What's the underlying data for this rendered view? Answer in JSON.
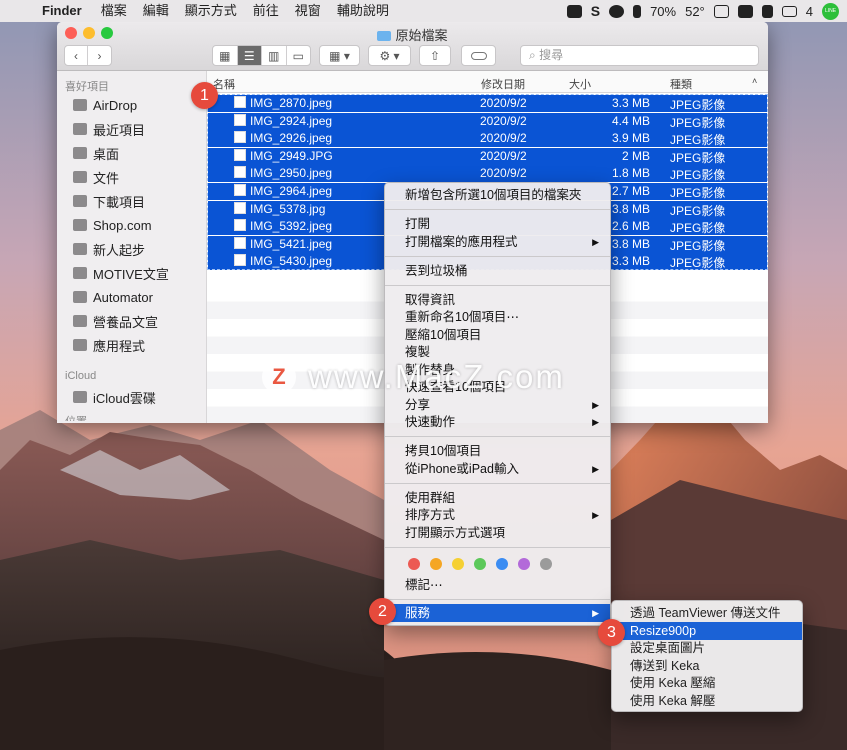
{
  "menubar": {
    "app": "Finder",
    "items": [
      "檔案",
      "編輯",
      "顯示方式",
      "前往",
      "視窗",
      "輔助說明"
    ],
    "battery": "70%",
    "temperature": "52°",
    "mail_count": "4",
    "line_label": "LINE"
  },
  "window": {
    "title": "原始檔案",
    "search_placeholder": "搜尋"
  },
  "sidebar": {
    "favorites_header": "喜好項目",
    "favorites": [
      "AirDrop",
      "最近項目",
      "桌面",
      "文件",
      "下載項目",
      "Shop.com",
      "新人起步",
      "MOTIVE文宣",
      "Automator",
      "營養品文宣",
      "應用程式"
    ],
    "icloud_header": "iCloud",
    "icloud": [
      "iCloud雲碟"
    ],
    "partial_header": "位置"
  },
  "columns": {
    "name": "名稱",
    "date": "修改日期",
    "size": "大小",
    "kind": "種類"
  },
  "files": [
    {
      "name": "IMG_2870.jpeg",
      "date": "2020/9/2",
      "size": "3.3 MB",
      "kind": "JPEG影像"
    },
    {
      "name": "IMG_2924.jpeg",
      "date": "2020/9/2",
      "size": "4.4 MB",
      "kind": "JPEG影像"
    },
    {
      "name": "IMG_2926.jpeg",
      "date": "2020/9/2",
      "size": "3.9 MB",
      "kind": "JPEG影像"
    },
    {
      "name": "IMG_2949.JPG",
      "date": "2020/9/2",
      "size": "2 MB",
      "kind": "JPEG影像"
    },
    {
      "name": "IMG_2950.jpeg",
      "date": "2020/9/2",
      "size": "1.8 MB",
      "kind": "JPEG影像"
    },
    {
      "name": "IMG_2964.jpeg",
      "date": "",
      "size": "2.7 MB",
      "kind": "JPEG影像"
    },
    {
      "name": "IMG_5378.jpg",
      "date": "",
      "size": "3.8 MB",
      "kind": "JPEG影像"
    },
    {
      "name": "IMG_5392.jpeg",
      "date": "",
      "size": "2.6 MB",
      "kind": "JPEG影像"
    },
    {
      "name": "IMG_5421.jpeg",
      "date": "",
      "size": "3.8 MB",
      "kind": "JPEG影像"
    },
    {
      "name": "IMG_5430.jpeg",
      "date": "",
      "size": "3.3 MB",
      "kind": "JPEG影像"
    }
  ],
  "context_menu": {
    "new_folder": "新增包含所選10個項目的檔案夾",
    "open": "打開",
    "open_with": "打開檔案的應用程式",
    "trash": "丟到垃圾桶",
    "get_info": "取得資訊",
    "rename": "重新命名10個項目⋯",
    "compress": "壓縮10個項目",
    "duplicate": "複製",
    "make_alias": "製作替身",
    "quick_look": "快速查看10個項目",
    "share": "分享",
    "quick_actions": "快速動作",
    "copy": "拷貝10個項目",
    "import_iphone": "從iPhone或iPad輸入",
    "use_groups": "使用群組",
    "sort_by": "排序方式",
    "show_view_options": "打開顯示方式選項",
    "tags": "標記⋯",
    "services": "服務",
    "tag_colors": [
      "#ec5a53",
      "#f5a623",
      "#f5d033",
      "#5cc85a",
      "#3b8cf2",
      "#b36ad9",
      "#9b9b9b"
    ]
  },
  "services_menu": {
    "teamviewer": "透過 TeamViewer 傳送文件",
    "resize": "Resize900p",
    "desktop_picture": "設定桌面圖片",
    "send_keka": "傳送到 Keka",
    "keka_compress": "使用 Keka 壓縮",
    "keka_extract": "使用 Keka 解壓"
  },
  "badges": {
    "one": "1",
    "two": "2",
    "three": "3"
  },
  "watermark": {
    "logo": "Z",
    "text": "www.MacZ.com"
  },
  "colors": {
    "selection": "#0a54d4",
    "menu_highlight": "#1b62d6",
    "badge": "#e64a3c"
  }
}
